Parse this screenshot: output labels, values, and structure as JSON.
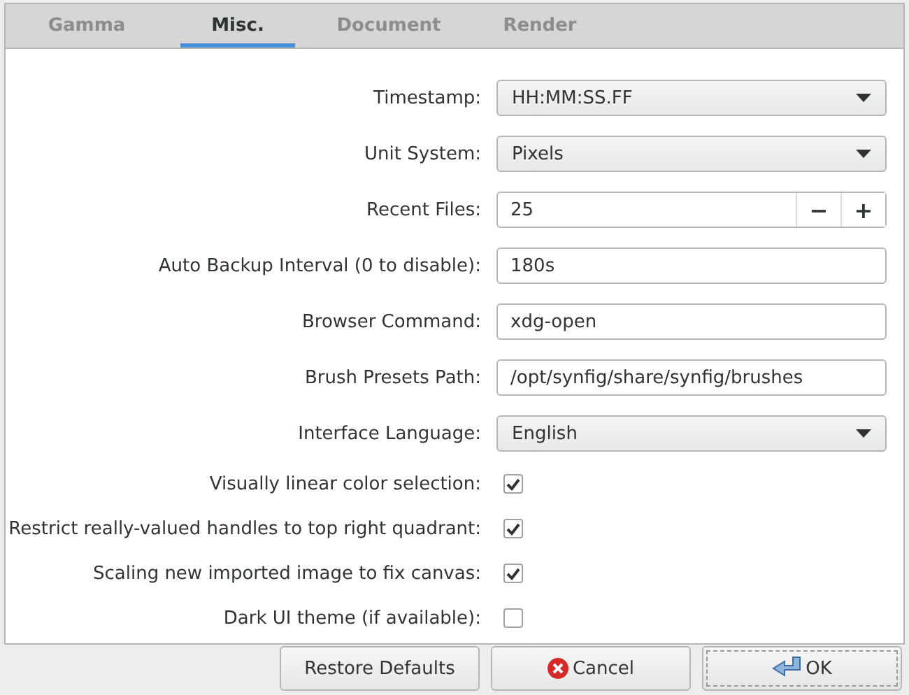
{
  "tabs": [
    {
      "label": "Gamma",
      "selected": false
    },
    {
      "label": "Misc.",
      "selected": true
    },
    {
      "label": "Document",
      "selected": false
    },
    {
      "label": "Render",
      "selected": false
    }
  ],
  "settings": [
    {
      "kind": "dropdown",
      "label": "Timestamp:",
      "value": "HH:MM:SS.FF"
    },
    {
      "kind": "dropdown",
      "label": "Unit System:",
      "value": "Pixels"
    },
    {
      "kind": "spin",
      "label": "Recent Files:",
      "value": "25",
      "minus": "−",
      "plus": "+"
    },
    {
      "kind": "entry",
      "label": "Auto Backup Interval (0 to disable):",
      "value": "180s"
    },
    {
      "kind": "entry",
      "label": "Browser Command:",
      "value": "xdg-open"
    },
    {
      "kind": "entry",
      "label": "Brush Presets Path:",
      "value": "/opt/synfig/share/synfig/brushes"
    },
    {
      "kind": "dropdown",
      "label": "Interface Language:",
      "value": "English"
    },
    {
      "kind": "checkbox",
      "label": "Visually linear color selection:",
      "checked": true
    },
    {
      "kind": "checkbox",
      "label": "Restrict really-valued handles to top right quadrant:",
      "checked": true
    },
    {
      "kind": "checkbox",
      "label": "Scaling new imported image to fix canvas:",
      "checked": true
    },
    {
      "kind": "checkbox",
      "label": "Dark UI theme (if available):",
      "checked": false
    }
  ],
  "buttons": [
    {
      "kind": "restore",
      "label": "Restore Defaults"
    },
    {
      "kind": "cancel",
      "label": "Cancel"
    },
    {
      "kind": "ok",
      "label": "OK"
    }
  ]
}
